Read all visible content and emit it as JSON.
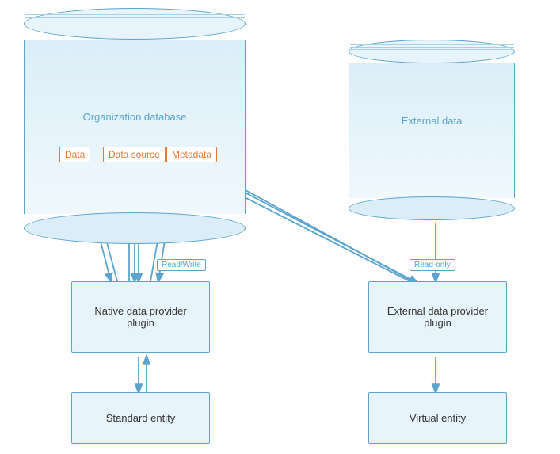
{
  "cylinders": {
    "org": {
      "label": "Organization database"
    },
    "ext": {
      "label": "External data"
    }
  },
  "tags": {
    "data": "Data",
    "datasource": "Data source",
    "metadata": "Metadata"
  },
  "badges": {
    "readwrite": "Read/Write",
    "readonly": "Read-only"
  },
  "boxes": {
    "native": "Native data provider\nplugin",
    "external_provider": "External data provider\nplugin",
    "standard": "Standard entity",
    "virtual": "Virtual entity"
  }
}
